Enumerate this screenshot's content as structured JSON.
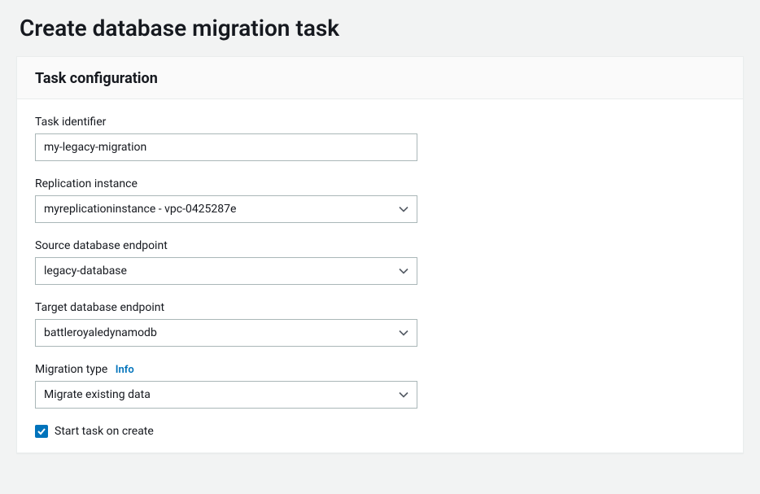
{
  "page": {
    "title": "Create database migration task"
  },
  "panel": {
    "heading": "Task configuration"
  },
  "fields": {
    "task_identifier": {
      "label": "Task identifier",
      "value": "my-legacy-migration"
    },
    "replication_instance": {
      "label": "Replication instance",
      "value": "myreplicationinstance - vpc-0425287e"
    },
    "source_endpoint": {
      "label": "Source database endpoint",
      "value": "legacy-database"
    },
    "target_endpoint": {
      "label": "Target database endpoint",
      "value": "battleroyaledynamodb"
    },
    "migration_type": {
      "label": "Migration type",
      "info_label": "Info",
      "value": "Migrate existing data"
    },
    "start_on_create": {
      "label": "Start task on create",
      "checked": true
    }
  }
}
